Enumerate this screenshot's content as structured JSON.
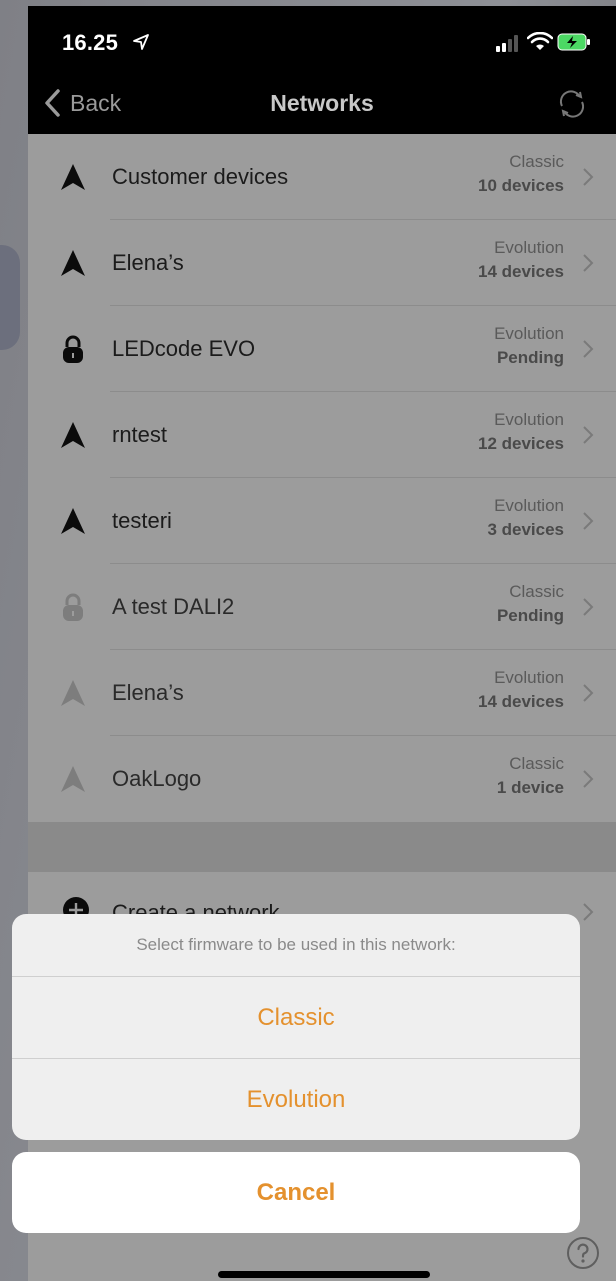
{
  "status": {
    "time": "16.25"
  },
  "nav": {
    "back_label": "Back",
    "title": "Networks"
  },
  "networks": [
    {
      "name": "Customer devices",
      "firmware": "Classic",
      "count": "10 devices",
      "icon": "arrow-logo-icon"
    },
    {
      "name": "Elena’s",
      "firmware": "Evolution",
      "count": "14 devices",
      "icon": "arrow-logo-icon"
    },
    {
      "name": "LEDcode  EVO",
      "firmware": "Evolution",
      "count": "Pending",
      "icon": "lock-icon"
    },
    {
      "name": "rntest",
      "firmware": "Evolution",
      "count": "12 devices",
      "icon": "arrow-logo-icon"
    },
    {
      "name": "testeri",
      "firmware": "Evolution",
      "count": "3 devices",
      "icon": "arrow-logo-icon"
    },
    {
      "name": "A test DALI2",
      "firmware": "Classic",
      "count": "Pending",
      "icon": "lock-icon"
    },
    {
      "name": "Elena’s",
      "firmware": "Evolution",
      "count": "14 devices",
      "icon": "arrow-logo-icon"
    },
    {
      "name": "OakLogo",
      "firmware": "Classic",
      "count": "1 device",
      "icon": "arrow-logo-icon"
    }
  ],
  "create": {
    "label": "Create a network"
  },
  "sheet": {
    "message": "Select firmware to be used in this network:",
    "options": [
      "Classic",
      "Evolution"
    ],
    "cancel": "Cancel"
  },
  "colors": {
    "accent": "#e4912e"
  }
}
